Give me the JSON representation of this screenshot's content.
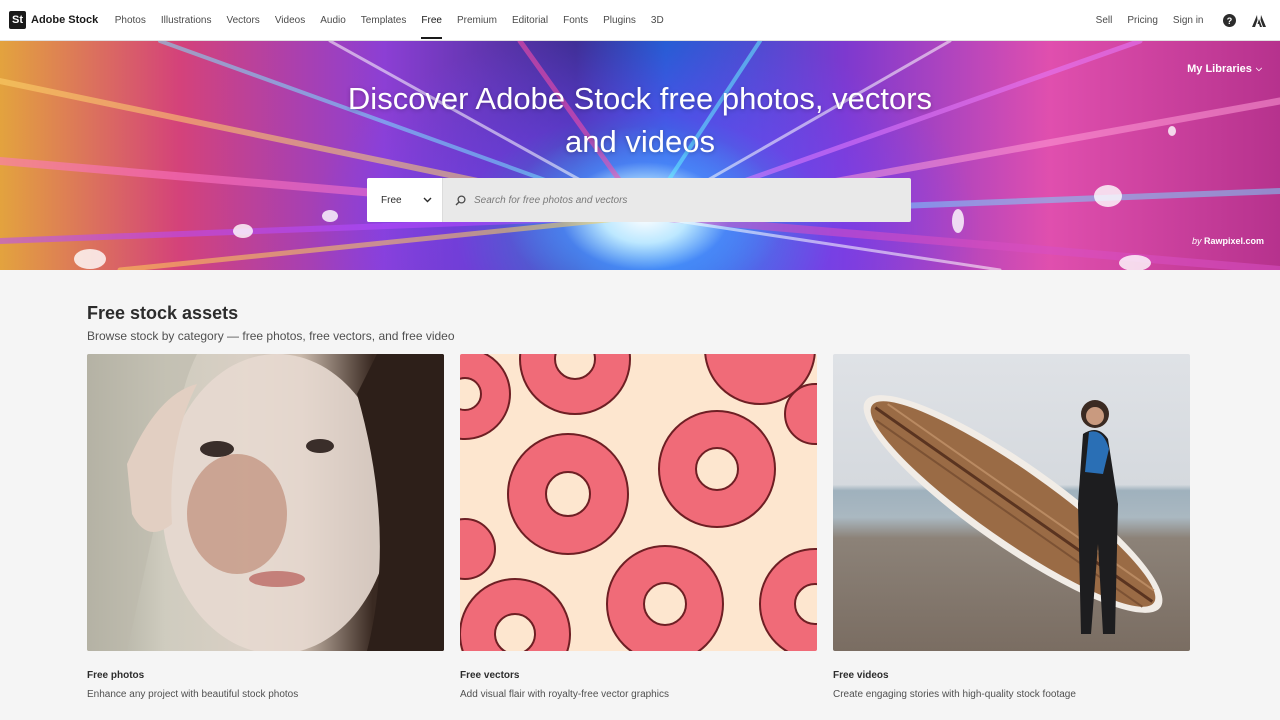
{
  "brand": {
    "logo_text": "St",
    "name": "Adobe Stock"
  },
  "nav": {
    "links": [
      {
        "label": "Photos"
      },
      {
        "label": "Illustrations"
      },
      {
        "label": "Vectors"
      },
      {
        "label": "Videos"
      },
      {
        "label": "Audio"
      },
      {
        "label": "Templates"
      },
      {
        "label": "Free",
        "active": true
      },
      {
        "label": "Premium"
      },
      {
        "label": "Editorial"
      },
      {
        "label": "Fonts"
      },
      {
        "label": "Plugins"
      },
      {
        "label": "3D"
      }
    ],
    "right": {
      "sell": "Sell",
      "pricing": "Pricing",
      "signin": "Sign in",
      "help_icon": "?",
      "adobe_icon": "adobe-logo"
    }
  },
  "hero": {
    "title": "Discover Adobe Stock free photos, vectors and videos",
    "my_libraries": "My Libraries",
    "credit_prefix": "by",
    "credit_name": "Rawpixel.com",
    "search": {
      "select_value": "Free",
      "placeholder": "Search for free photos and vectors",
      "icon": "search-icon"
    }
  },
  "section": {
    "title": "Free stock assets",
    "subtitle": "Browse stock by category — free photos, free vectors, and free video"
  },
  "cards": [
    {
      "title": "Free photos",
      "description": "Enhance any project with beautiful stock photos"
    },
    {
      "title": "Free vectors",
      "description": "Add visual flair with royalty-free vector graphics"
    },
    {
      "title": "Free videos",
      "description": "Create engaging stories with high-quality stock footage"
    }
  ],
  "colors": {
    "accent": "#1a1a1a",
    "background": "#f5f5f5"
  }
}
